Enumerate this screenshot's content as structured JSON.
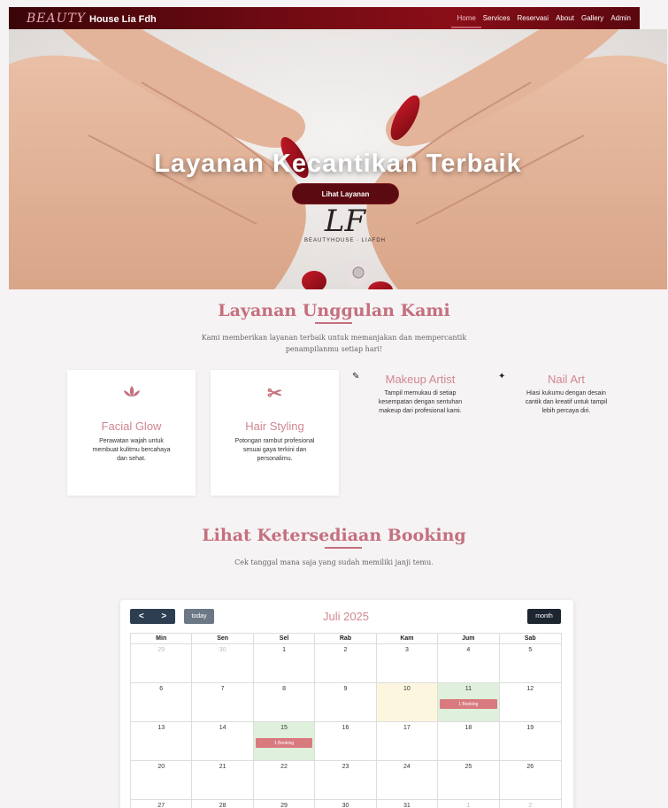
{
  "nav": {
    "brand_script": "BEAUTY",
    "brand_name": "House Lia Fdh",
    "links": [
      "Home",
      "Services",
      "Reservasi",
      "About",
      "Gallery",
      "Admin"
    ],
    "active": "Home"
  },
  "hero": {
    "title": "Layanan Kecantikan Terbaik",
    "button": "Lihat Layanan",
    "logo_mark": "LF",
    "logo_text": "BEAUTYHOUSE · LIAFDH"
  },
  "services": {
    "title": "Layanan Unggulan Kami",
    "subtitle_line1": "Kami memberikan layanan terbaik untuk memanjakan dan mempercantik",
    "subtitle_line2": "penampilanmu setiap hari!",
    "cards": [
      {
        "icon": "lotus-icon",
        "title": "Facial Glow",
        "desc": [
          "Perawatan wajah untuk",
          "membuat kulitmu bercahaya",
          "dan sehat."
        ]
      },
      {
        "icon": "scissors-icon",
        "title": "Hair Styling",
        "desc": [
          "Potongan rambut profesional",
          "sesuai gaya terkini dan",
          "personalimu."
        ]
      }
    ],
    "floating": [
      {
        "icon": "brush-icon",
        "title": "Makeup Artist",
        "desc": [
          "Tampil memukau di setiap",
          "kesempatan dengan sentuhan",
          "makeup dari profesional kami."
        ]
      },
      {
        "icon": "hand-sparkle-icon",
        "title": "Nail Art",
        "desc": [
          "Hiasi kukumu dengan desain",
          "cantik dan kreatif untuk tampil",
          "lebih percaya diri."
        ]
      }
    ]
  },
  "booking": {
    "title": "Lihat Ketersediaan Booking",
    "subtitle": "Cek tanggal mana saja yang sudah memiliki janji temu."
  },
  "calendar": {
    "prev": "<",
    "next": ">",
    "today_label": "today",
    "title": "Juli 2025",
    "view_label": "month",
    "days": [
      "Min",
      "Sen",
      "Sel",
      "Rab",
      "Kam",
      "Jum",
      "Sab"
    ],
    "weeks": [
      [
        {
          "n": "29",
          "o": true
        },
        {
          "n": "30",
          "o": true
        },
        {
          "n": "1"
        },
        {
          "n": "2"
        },
        {
          "n": "3"
        },
        {
          "n": "4"
        },
        {
          "n": "5"
        }
      ],
      [
        {
          "n": "6"
        },
        {
          "n": "7"
        },
        {
          "n": "8"
        },
        {
          "n": "9"
        },
        {
          "n": "10",
          "today": true
        },
        {
          "n": "11",
          "event": "1 Booking"
        },
        {
          "n": "12"
        }
      ],
      [
        {
          "n": "13"
        },
        {
          "n": "14"
        },
        {
          "n": "15",
          "event": "1 Booking"
        },
        {
          "n": "16"
        },
        {
          "n": "17"
        },
        {
          "n": "18"
        },
        {
          "n": "19"
        }
      ],
      [
        {
          "n": "20"
        },
        {
          "n": "21"
        },
        {
          "n": "22"
        },
        {
          "n": "23"
        },
        {
          "n": "24"
        },
        {
          "n": "25"
        },
        {
          "n": "26"
        }
      ],
      [
        {
          "n": "27"
        },
        {
          "n": "28"
        },
        {
          "n": "29"
        },
        {
          "n": "30"
        },
        {
          "n": "31"
        },
        {
          "n": "1",
          "o": true
        },
        {
          "n": "2",
          "o": true
        }
      ]
    ]
  },
  "colors": {
    "accent": "#c4707e",
    "nav_bg": "#6d0a12",
    "booking_bg": "#dff0dc",
    "event": "#d97a7f",
    "today": "#fdf6df"
  }
}
